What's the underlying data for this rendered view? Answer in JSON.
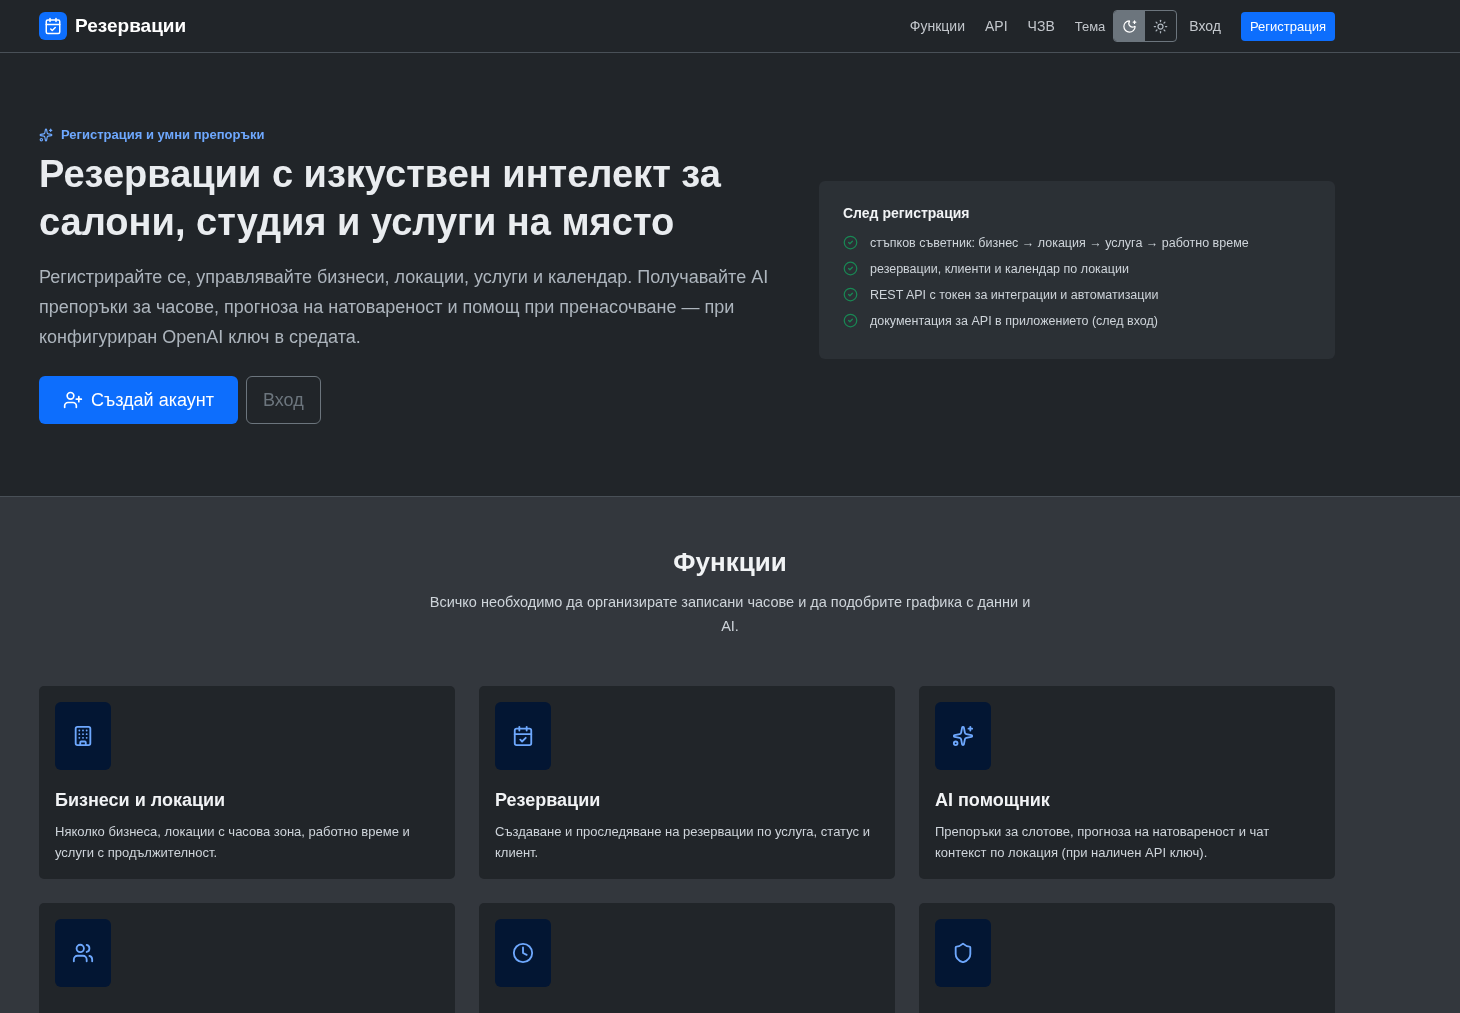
{
  "brand": "Резервации",
  "nav": [
    {
      "label": "Функции"
    },
    {
      "label": "API"
    },
    {
      "label": "ЧЗВ"
    }
  ],
  "theme": {
    "label": "Тема",
    "options": [
      {
        "selected": true
      },
      {
        "selected": false
      }
    ]
  },
  "login": "Вход",
  "register": "Регистрация",
  "hero": {
    "eyebrow": "Регистрация и умни препоръки",
    "title": "Резервации с изкуствен интелект за салони, студия и услуги на място",
    "lead": "Регистрирайте се, управлявайте бизнеси, локации, услуги и календар. Получавайте AI препоръки за часове, прогноза на натовареност и помощ при пренасочване — при конфигуриран OpenAI ключ в средата.",
    "primary": "Създай акаунт",
    "secondary": "Вход"
  },
  "after": {
    "title": "След регистрация",
    "items": [
      "стъпков съветник: бизнес → локация → услуга → работно време",
      "резервации, клиенти и календар по локации",
      "REST API с токен за интеграции и автоматизации",
      "документация за API в приложението (след вход)"
    ]
  },
  "features": {
    "title": "Функции",
    "subtitle": "Всичко необходимо да организирате записани часове и да подобрите графика с данни и AI.",
    "cards": [
      {
        "kind": "full",
        "title": "Бизнеси и локации",
        "text": "Няколко бизнеса, локации с часова зона, работно време и услуги с продължителност."
      },
      {
        "kind": "full",
        "title": "Резервации",
        "text": "Създаване и проследяване на резервации по услуга, статус и клиент."
      },
      {
        "kind": "full",
        "title": "AI помощник",
        "text": "Препоръки за слотове, прогноза на натовареност и чат контекст по локация (при наличен API ключ)."
      },
      {
        "kind": "icon_only"
      },
      {
        "kind": "icon_only"
      },
      {
        "kind": "icon_only"
      }
    ]
  }
}
